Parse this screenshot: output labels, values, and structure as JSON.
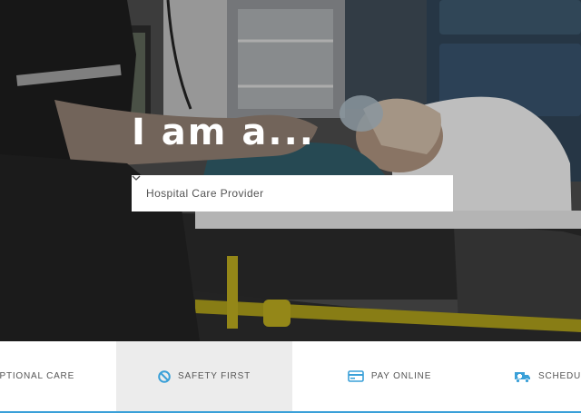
{
  "hero": {
    "headline": "I am a...",
    "select": {
      "value": "Hospital Care Provider"
    }
  },
  "nav": {
    "items": [
      {
        "label": "EPTIONAL CARE",
        "icon": "none"
      },
      {
        "label": "SAFETY FIRST",
        "icon": "prohibited-icon",
        "active": true
      },
      {
        "label": "PAY ONLINE",
        "icon": "credit-card-icon"
      },
      {
        "label": "SCHEDUL",
        "icon": "ambulance-icon"
      }
    ]
  },
  "colors": {
    "accent": "#3aa0d8",
    "active_tab_bg": "#ececec"
  }
}
